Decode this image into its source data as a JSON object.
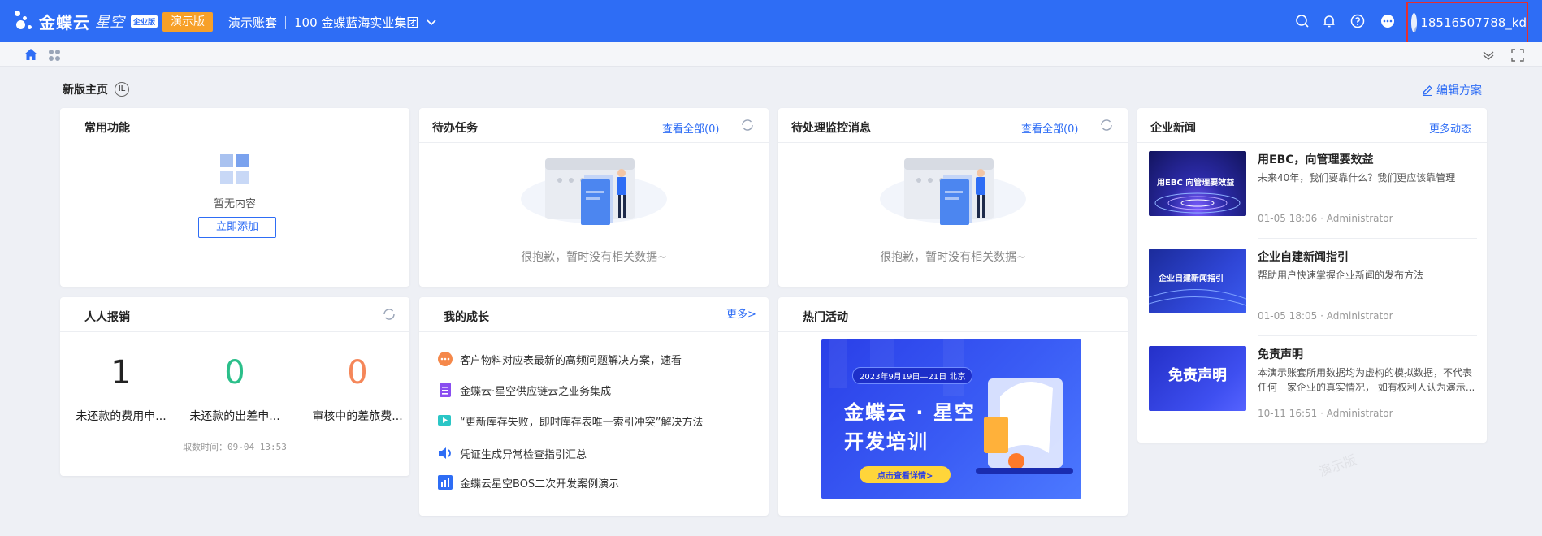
{
  "header": {
    "logo_text": "金蝶云",
    "logo_sub": "星空",
    "logo_badge": "企业版",
    "demo_label": "演示版",
    "account_set": "演示账套",
    "org": "100 金蝶蓝海实业集团",
    "username": "18516507788_kd"
  },
  "page": {
    "title": "新版主页",
    "title_badge": "IL",
    "edit_label": "编辑方案"
  },
  "common": {
    "title": "常用功能",
    "empty": "暂无内容",
    "add_label": "立即添加"
  },
  "todo": {
    "title": "待办任务",
    "link": "查看全部(0)",
    "empty": "很抱歉，暂时没有相关数据~"
  },
  "monitor": {
    "title": "待处理监控消息",
    "link": "查看全部(0)",
    "empty": "很抱歉，暂时没有相关数据~"
  },
  "expense": {
    "title": "人人报销",
    "stats": [
      {
        "value": "1",
        "label": "未还款的费用申...",
        "color": "#222222"
      },
      {
        "value": "0",
        "label": "未还款的出差申...",
        "color": "#2bbf8a"
      },
      {
        "value": "0",
        "label": "审核中的差旅费...",
        "color": "#f5875a"
      }
    ],
    "fetch_time": "取数时间：09-04 13:53"
  },
  "growth": {
    "title": "我的成长",
    "more": "更多>",
    "items": [
      {
        "text": "客户物料对应表最新的高频问题解决方案，速看",
        "icon": "chat-icon"
      },
      {
        "text": "金蝶云·星空供应链云之业务集成",
        "icon": "document-icon"
      },
      {
        "text": "“更新库存失败，即时库存表唯一索引冲突”解决方法",
        "icon": "video-icon"
      },
      {
        "text": "凭证生成异常检查指引汇总",
        "icon": "speaker-icon"
      },
      {
        "text": "金蝶云星空BOS二次开发案例演示",
        "icon": "chart-icon"
      }
    ]
  },
  "activity": {
    "title": "热门活动",
    "banner_date": "2023年9月19日—21日 北京",
    "banner_line1": "金蝶云 · 星空",
    "banner_line2": "开发培训",
    "banner_btn": "点击查看详情>"
  },
  "news": {
    "title": "企业新闻",
    "more": "更多动态",
    "items": [
      {
        "title": "用EBC，向管理要效益",
        "desc": "未来40年，我们要靠什么？我们更应该靠管理",
        "meta": "01-05 18:06 · Administrator",
        "img_text": "用EBC 向管理要效益"
      },
      {
        "title": "企业自建新闻指引",
        "desc": "帮助用户快速掌握企业新闻的发布方法",
        "meta": "01-05 18:05 · Administrator",
        "img_text": "企业自建新闻指引"
      },
      {
        "title": "免责声明",
        "desc": "本演示账套所用数据均为虚构的模拟数据，不代表任何一家企业的真实情况， 如有权利人认为演示...",
        "meta": "10-11 16:51 · Administrator",
        "img_text": "免责声明"
      }
    ]
  },
  "watermark": "演示版",
  "colors": {
    "brand": "#2e6df5",
    "demo": "#f7a028",
    "highlight": "#e52e2e"
  }
}
